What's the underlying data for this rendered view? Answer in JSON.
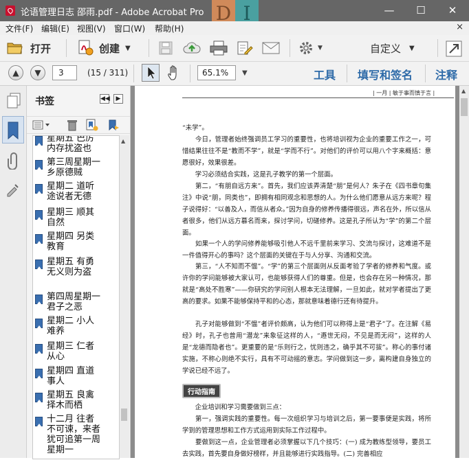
{
  "window": {
    "title": "论语管理日志 邵雨.pdf - Adobe Acrobat Pro",
    "watermark": [
      "D",
      "I"
    ],
    "controls": [
      "—",
      "☐",
      "✕"
    ]
  },
  "menubar": {
    "items": [
      "文件(F)",
      "编辑(E)",
      "视图(V)",
      "窗口(W)",
      "帮助(H)"
    ],
    "close_glyph": "×"
  },
  "toolbar": {
    "open_label": "打开",
    "create_label": "创建",
    "customize_label": "自定义"
  },
  "navbar": {
    "page_value": "3",
    "page_count": "(15 / 311)",
    "zoom_value": "65.1%",
    "tools_label": "工具",
    "fill_sign_label": "填写和签名",
    "comment_label": "注释"
  },
  "bookmarks": {
    "title": "书签",
    "items": [
      "星期五 巴厉内存扰盗也",
      "第三周星期一 乡原德贼",
      "星期二 道听途说者无德",
      "星期三 顺其自然",
      "星期四 另类教育",
      "星期五 有勇无义则为盗",
      "第四周星期一 君子之恶",
      "星期二 小人难养",
      "星期三 仁者从心",
      "星期四 直道事人",
      "星期五 良禽择木而栖",
      "十二月 往者不可谏，来者犹可追第一周星期一"
    ]
  },
  "document": {
    "running_head": "| 一月 | 敏于事而慎于言 |",
    "action_tag": "行动指南",
    "paragraphs": [
      "“未学”。",
      "　　今日，管理者始终强调员工学习的重要性，也将培训视为企业的重要工作之一，可惜结果往往不是“教而不学”，就是“学而不行”。对他们的评价可以用八个字来概括：意愿很好，效果很差。",
      "　　学习必须结合实践，这是孔子教学的第一个层面。",
      "　　第二，“有朋自远方来”。首先，我们应该弄清楚“朋”是何人？朱子在《四书章句集注》中说“朋，同类也”，即拥有相同观念和思想的人。为什么他们愿意从远方来呢？程子说得好：“以善及人，而信从者众。”因为自身的修养传播得很远，声名在外，所以信从者很多，他们从远方慕名而来，探讨学问，切磋修养。这是孔子所认为“学”的第二个层面。",
      "　　如果一个人的学问修养能够吸引他人不远千里前来学习、交流与探讨，这难道不是一件值得开心的事吗？这个层面的关键在于与人分享、沟通和交流。",
      "　　第三，“人不知而不愠”。“学”的第三个层面则从反面考验了学者的修养和气度。或许你的学问能够被大家认可，也能够获得人们的尊重。但是，也会存在另一种情况，那就是“高处不胜寒”——你研究的学问别人根本无法理解，一旦如此，就对学者提出了更高的要求。如果不能够保持平和的心态，那就意味着德行还有待提升。",
      "　　孔子对能够做到“不愠”者评价颇高，认为他们可以称得上是“君子”了。在注解《易经》时，孔子也曾用“潜龙”来象征这样的人，“遯世无闷，不见是而无闷”，这样的人是“龙德而隐者也”。更重要的是“乐则行之，忧则违之，确乎其不可拔”。称心的事付诸实施，不称心则绝不实行，具有不可动摇的意志。学问做到这一步，离构建自身独立的学说已经不远了。",
      "　　企业培训和学习需要做到三点：",
      "　　第一，强调实践的重要性。每一次组织学习与培训之后，第一要事便是实践，将所学到的管理思想和工作方式运用到实际工作过程中。",
      "　　要做到这一点，企业管理者必须掌握以下几个技巧：(一) 成为教练型领导，要员工去实践，首先要自身做好榜样，并且能够进行实践指导。(二) 完善相应"
    ]
  }
}
